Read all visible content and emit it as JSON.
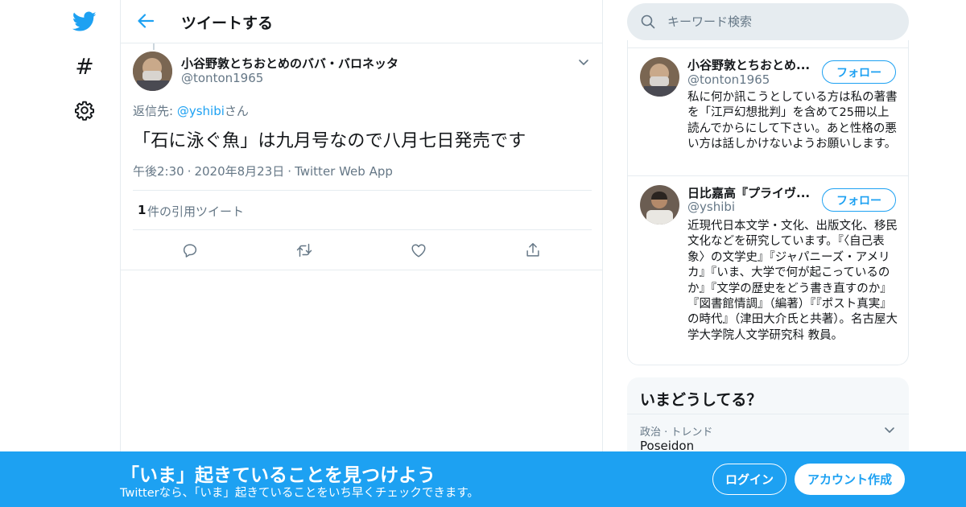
{
  "colors": {
    "accent": "#1da1f2",
    "text": "#14171a",
    "muted": "#657786",
    "border": "#e6ecf0"
  },
  "nav": {
    "items": [
      {
        "icon": "twitter-logo-icon"
      },
      {
        "icon": "hashtag-icon",
        "glyph": "#"
      },
      {
        "icon": "gear-icon"
      }
    ]
  },
  "header": {
    "title": "ツイートする",
    "back_icon": "arrow-left-icon"
  },
  "tweet": {
    "author_name": "小谷野敦とちおとめのババ・バロネッタ",
    "author_handle": "@tonton1965",
    "reply_prefix": "返信先: ",
    "reply_mention": "@yshibi",
    "reply_suffix": "さん",
    "text": "「石に泳ぐ魚」は九月号なので八月七日発売です",
    "time": "午後2:30",
    "date": "2020年8月23日",
    "source": "Twitter Web App",
    "quote_count": "1",
    "quote_label": "件の引用ツイート",
    "actions": [
      "reply-icon",
      "retweet-icon",
      "like-icon",
      "share-icon"
    ]
  },
  "search": {
    "placeholder": "キーワード検索"
  },
  "users": [
    {
      "name": "小谷野敦とちおとめ...",
      "handle": "@tonton1965",
      "follow_label": "フォロー",
      "bio": "私に何か訊こうとしている方は私の著書を「江戸幻想批判」を含めて25冊以上読んでからにして下さい。あと性格の悪い方は話しかけないようお願いします。"
    },
    {
      "name": "日比嘉高『プライヴ...",
      "handle": "@yshibi",
      "follow_label": "フォロー",
      "bio": "近現代日本文学・文化、出版文化、移民文化などを研究しています。『〈自己表象〉の文学史』『ジャパニーズ・アメリカ』『いま、大学で何が起こっているのか』『文学の歴史をどう書き直すのか』『図書館情調』（編著）『『ポスト真実』の時代』（津田大介氏と共著）。名古屋大学大学院人文学研究科 教員。"
    }
  ],
  "trends": {
    "title": "いまどうしてる？",
    "items": [
      {
        "context": "政治 · トレンド",
        "name": "Poseidon"
      }
    ]
  },
  "banner": {
    "title": "「いま」起きていることを見つけよう",
    "subtitle": "Twitterなら、「いま」起きていることをいち早くチェックできます。",
    "login_label": "ログイン",
    "signup_label": "アカウント作成"
  }
}
